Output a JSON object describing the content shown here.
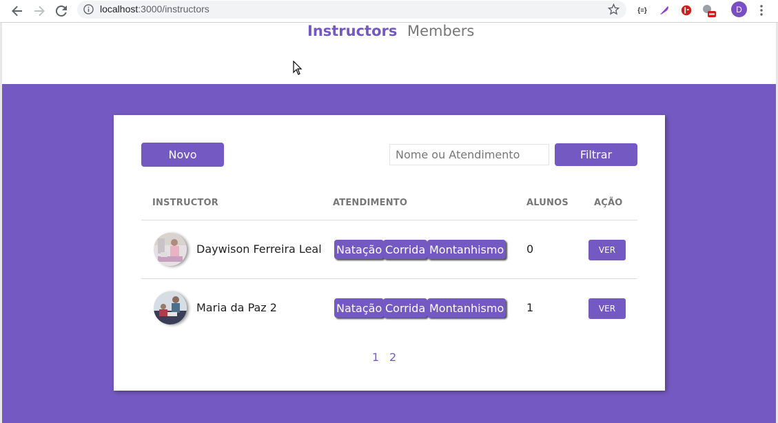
{
  "browser": {
    "url_host": "localhost",
    "url_path": ":3000/instructors",
    "profile_initial": "D",
    "ext_json_label": "{≡}"
  },
  "nav": {
    "instructors_label": "Instructors",
    "members_label": "Members"
  },
  "toolbar": {
    "new_label": "Novo",
    "search_placeholder": "Nome ou Atendimento",
    "filter_label": "Filtrar"
  },
  "table": {
    "headers": [
      "INSTRUCTOR",
      "ATENDIMENTO",
      "ALUNOS",
      "AÇÃO"
    ],
    "rows": [
      {
        "name": "Daywison Ferreira Leal",
        "services": [
          "Natação",
          "Corrida",
          "Montanhismo"
        ],
        "students": "0",
        "action": "VER"
      },
      {
        "name": "Maria da Paz 2",
        "services": [
          "Natação",
          "Corrida",
          "Montanhismo"
        ],
        "students": "1",
        "action": "VER"
      }
    ]
  },
  "pagination": [
    "1",
    "2"
  ],
  "colors": {
    "accent": "#7559c2",
    "header_text": "#777777"
  }
}
